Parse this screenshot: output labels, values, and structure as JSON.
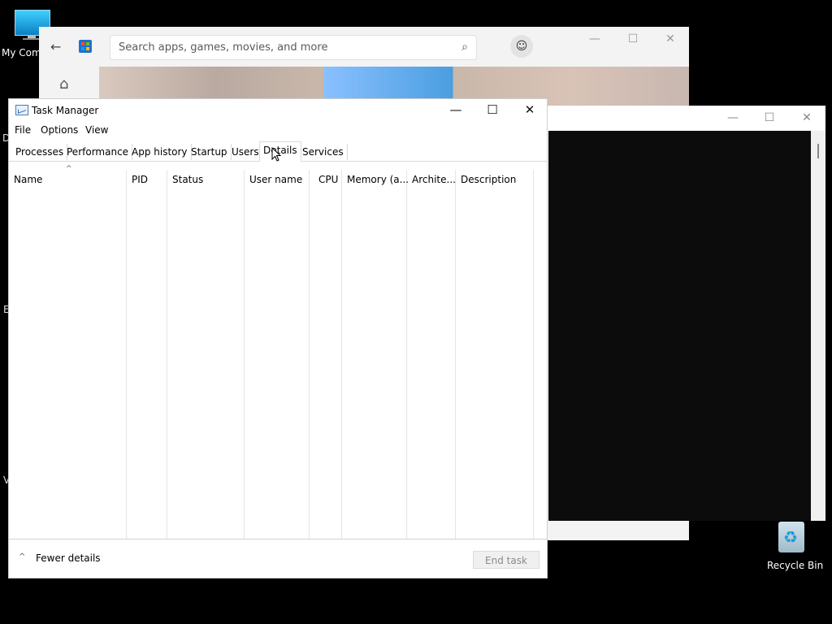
{
  "desktop": {
    "icons": [
      {
        "label": "My Com"
      },
      {
        "label": "Recycle Bin"
      }
    ],
    "edge_letters": [
      "D",
      "E",
      "V"
    ]
  },
  "store": {
    "search_placeholder": "Search apps, games, movies, and more",
    "back_icon": "back-arrow-icon",
    "search_icon": "search-icon",
    "avatar_icon": "person-icon",
    "home_icon": "home-icon",
    "controls": {
      "minimize": "—",
      "maximize": "☐",
      "close": "✕"
    }
  },
  "console": {
    "controls": {
      "minimize": "—",
      "maximize": "☐",
      "close": "✕"
    }
  },
  "taskmanager": {
    "title": "Task Manager",
    "controls": {
      "minimize": "—",
      "maximize": "☐",
      "close": "✕"
    },
    "menu": [
      "File",
      "Options",
      "View"
    ],
    "tabs": [
      "Processes",
      "Performance",
      "App history",
      "Startup",
      "Users",
      "Details",
      "Services"
    ],
    "selected_tab": "Details",
    "columns": [
      "Name",
      "PID",
      "Status",
      "User name",
      "CPU",
      "Memory (a...",
      "Archite...",
      "Description"
    ],
    "sort_indicator": "^",
    "footer": {
      "fewer_details": "Fewer details",
      "fewer_icon": "^",
      "end_task": "End task"
    }
  }
}
